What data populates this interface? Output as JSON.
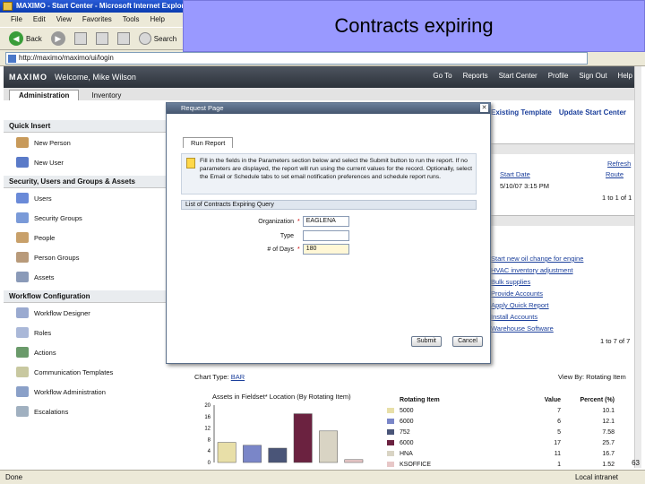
{
  "browser": {
    "title": "MAXIMO - Start Center - Microsoft Internet Explorer",
    "menu": [
      "File",
      "Edit",
      "View",
      "Favorites",
      "Tools",
      "Help"
    ],
    "back_label": "Back",
    "search_label": "Search",
    "address_value": "http://maximo/maximo/ui/login",
    "status_text": "Done",
    "status_zone": "Local intranet"
  },
  "slide": {
    "title": "Contracts expiring"
  },
  "maximo": {
    "logo": "MAXIMO",
    "welcome": "Welcome, Mike Wilson",
    "nav": [
      "Go To",
      "Reports",
      "Start Center",
      "Profile",
      "Sign Out",
      "Help"
    ],
    "tabs": [
      "Administration",
      "Inventory"
    ],
    "right_links": [
      "Existing Template",
      "Update Start Center"
    ]
  },
  "left": {
    "quick_insert": "Quick Insert",
    "qi_items": [
      "New Person",
      "New User"
    ],
    "security_hdr": "Security, Users and Groups & Assets",
    "sec_items": [
      "Users",
      "Security Groups",
      "People",
      "Person Groups",
      "Assets"
    ],
    "workflow_hdr": "Workflow Configuration",
    "wf_items": [
      "Workflow Designer",
      "Roles",
      "Actions",
      "Communication Templates",
      "Workflow Administration",
      "Escalations"
    ]
  },
  "right": {
    "refresh": "Refresh",
    "start_date_hdr": "Start Date",
    "route_hdr": "Route",
    "start_date_val": "5/10/07 3:15 PM",
    "count1": "1 to 1 of 1",
    "rows": [
      "Start new oil change for engine",
      "HVAC inventory adjustment",
      "Bulk supplies",
      "Provide Accounts",
      "Apply Quick Report",
      "Install Accounts",
      "Warehouse Software"
    ],
    "count2": "1 to 7 of 7",
    "view_by": "View By: Rotating Item"
  },
  "dialog": {
    "title": "Request Page",
    "tab": "Run Report",
    "info": "Fill in the fields in the Parameters section below and select the Submit button to run the report. If no parameters are displayed, the report will run using the current values for the record. Optionally, select the Email or Schedule tabs to set email notification preferences and schedule report runs.",
    "section": "List of Contracts Expiring Query",
    "fields": [
      {
        "label": "Organization",
        "value": "EAGLENA",
        "required": true
      },
      {
        "label": "Type",
        "value": "",
        "required": false
      },
      {
        "label": "# of Days",
        "value": "180",
        "required": true
      }
    ],
    "submit": "Submit",
    "cancel": "Cancel"
  },
  "chart_section": {
    "chart_type_label": "Chart Type:",
    "chart_type_value": "BAR",
    "chart_title": "Assets in Fieldset* Location (By Rotating Item)",
    "legend_hdr": [
      "Rotating Item",
      "Value",
      "Percent (%)"
    ]
  },
  "chart_data": {
    "type": "bar",
    "title": "Assets in Fieldset* Location (By Rotating Item)",
    "categories": [
      "5000",
      "6000",
      "752",
      "6000",
      "HNA",
      "KSOFFICE"
    ],
    "values": [
      7,
      6,
      5,
      17,
      11,
      1
    ],
    "ylim": [
      0,
      20
    ],
    "yticks": [
      0,
      4,
      8,
      12,
      16,
      20
    ],
    "colors": [
      "#e8dfa8",
      "#7a86c8",
      "#4a5578",
      "#6b2240",
      "#d9d4c4",
      "#e7c7c7"
    ],
    "percents": [
      "10.1",
      "12.1",
      "7.58",
      "25.7",
      "16.7",
      "1.52"
    ]
  },
  "page_number": "63"
}
